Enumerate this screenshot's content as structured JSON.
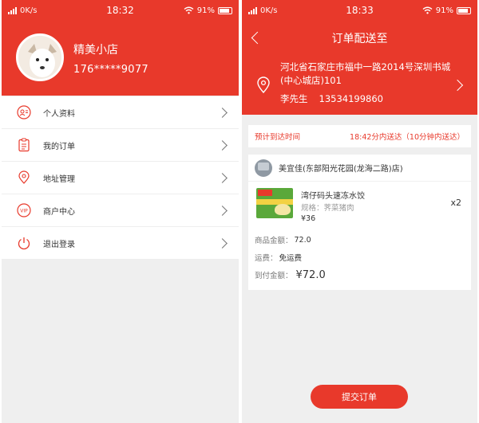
{
  "colors": {
    "brand": "#e8392b",
    "background": "#efefef"
  },
  "left": {
    "status": {
      "speed": "0K/s",
      "time": "18:32",
      "battery": "91%"
    },
    "profile": {
      "name": "精美小店",
      "phone": "176*****9077"
    },
    "menu": [
      {
        "label": "个人资料",
        "icon": "person-card-icon"
      },
      {
        "label": "我的订单",
        "icon": "clipboard-icon"
      },
      {
        "label": "地址管理",
        "icon": "location-pin-icon"
      },
      {
        "label": "商户中心",
        "icon": "vip-icon"
      },
      {
        "label": "退出登录",
        "icon": "power-icon"
      }
    ]
  },
  "right": {
    "status": {
      "speed": "0K/s",
      "time": "18:33",
      "battery": "91%"
    },
    "title": "订单配送至",
    "address": "河北省石家庄市福中一路2014号深圳书城(中心城店)101",
    "contact_name": "李先生",
    "contact_phone": "13534199860",
    "eta_label": "预计到达时间",
    "eta_value": "18:42分内送达（10分钟内送达）",
    "store_name": "美宜佳(东部阳光花园(龙海二路)店)",
    "product": {
      "name": "湾仔码头速冻水饺",
      "spec": "规格：荠菜猪肉",
      "price": "¥36",
      "qty": "x2"
    },
    "summary": {
      "goods_label": "商品金额：",
      "goods_value": "72.0",
      "shipping_label": "运费：",
      "shipping_value": "免运费",
      "total_label": "到付金额：",
      "total_value": "¥72.0"
    },
    "submit_label": "提交订单"
  }
}
